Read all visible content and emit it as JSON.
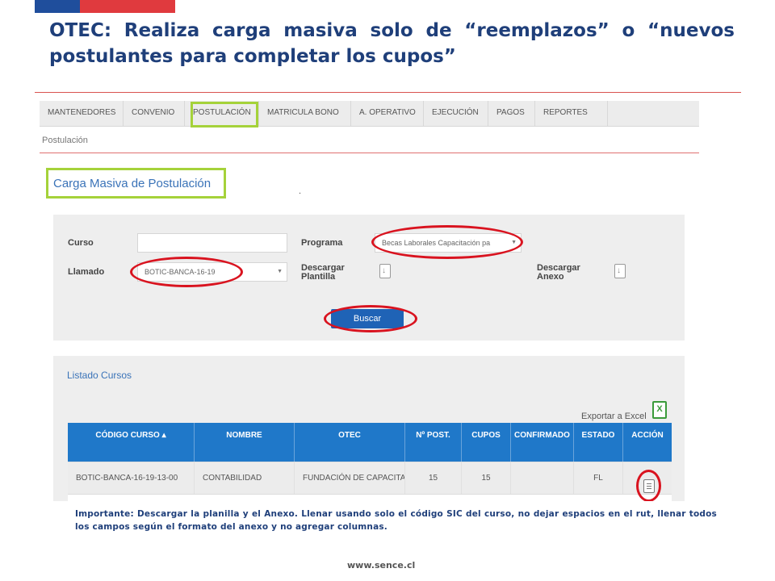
{
  "slide": {
    "title_line1": "OTEC: Realiza carga masiva solo de “reemplazos” o “nuevos",
    "title_line2": "postulantes para completar los cupos”",
    "note": "Importante: Descargar la planilla y el Anexo. Llenar usando solo el código SIC del curso, no dejar espacios en el rut, llenar todos los campos según el formato del anexo y no agregar columnas.",
    "footer": "www.sence.cl",
    "colors": {
      "brand_blue": "#1f3f7a",
      "flag_red": "#e03a3e",
      "highlight_green": "#a5d23a",
      "annotation_red": "#d9131f",
      "table_header": "#1f78c9"
    }
  },
  "menu": {
    "items": [
      "MANTENEDORES",
      "CONVENIO",
      "POSTULACIÓN",
      "MATRICULA BONO",
      "A. OPERATIVO",
      "EJECUCIÓN",
      "PAGOS",
      "REPORTES"
    ]
  },
  "breadcrumb": "Postulación",
  "page_title": "Carga Masiva de Postulación",
  "page_dot": ".",
  "form": {
    "curso_label": "Curso",
    "curso_value": "",
    "programa_label": "Programa",
    "programa_value": "Becas Laborales Capacitación pa",
    "llamado_label": "Llamado",
    "llamado_value": "BOTIC-BANCA-16-19",
    "descargar_plantilla_label_1": "Descargar",
    "descargar_plantilla_label_2": "Plantilla",
    "descargar_anexo_label_1": "Descargar",
    "descargar_anexo_label_2": "Anexo",
    "select_caret": "▼",
    "buscar_label": "Buscar"
  },
  "listado": {
    "title": "Listado Cursos",
    "export_label": "Exportar a Excel",
    "excel_icon": "excel-icon",
    "columns": [
      "CÓDIGO CURSO ▴",
      "NOMBRE",
      "OTEC",
      "Nº POST.",
      "CUPOS",
      "CONFIRMADO",
      "ESTADO",
      "ACCIÓN"
    ],
    "rows": [
      [
        "BOTIC-BANCA-16-19-13-00",
        "CONTABILIDAD",
        "FUNDACIÓN DE CAPACITACIÓN",
        "15",
        "15",
        "",
        "FL",
        "document-icon"
      ]
    ]
  }
}
